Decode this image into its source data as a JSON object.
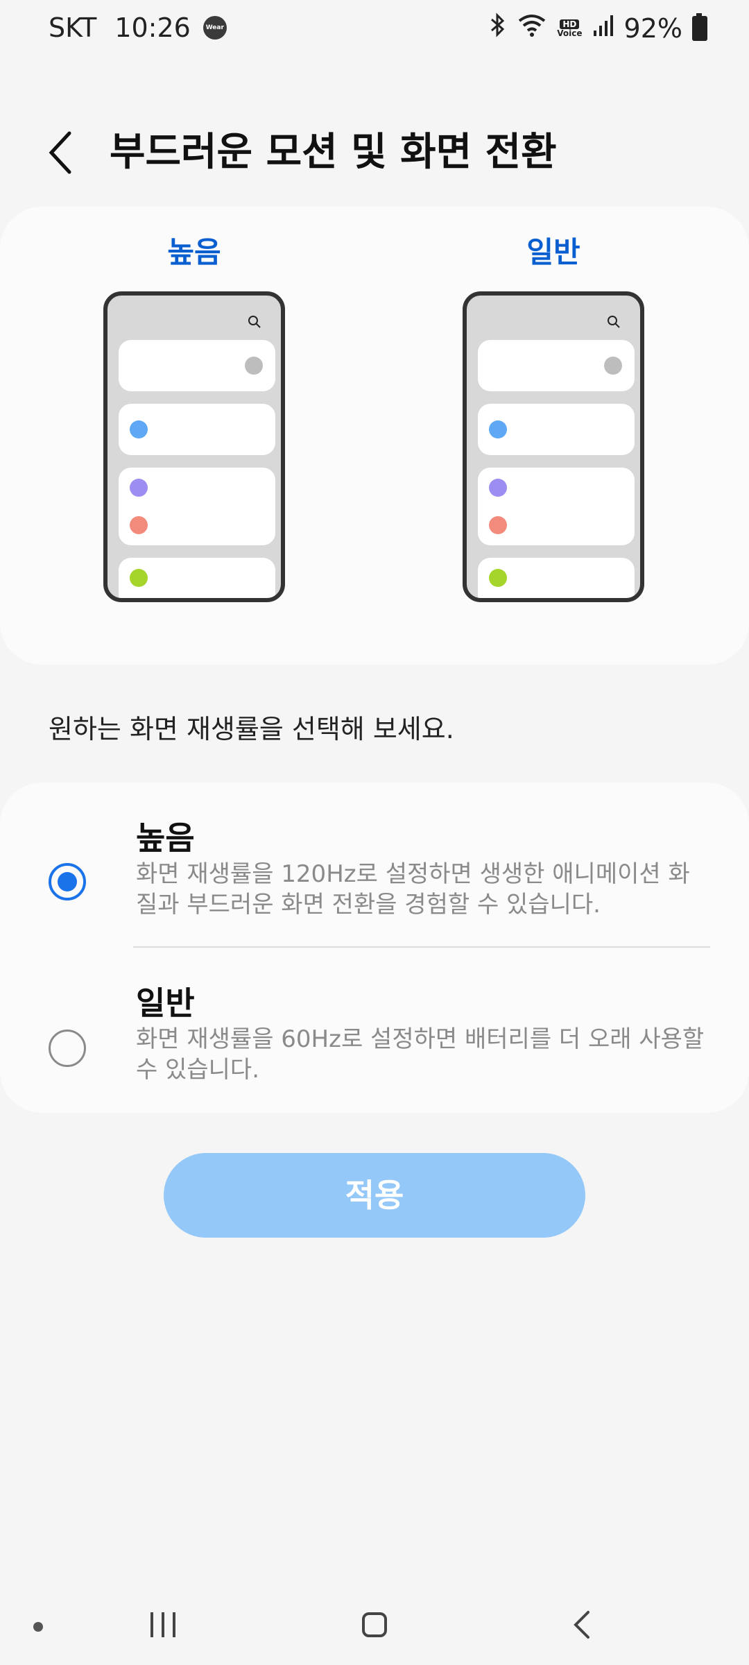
{
  "status_bar": {
    "carrier": "SKT",
    "time": "10:26",
    "wear_icon_label": "Wear",
    "hd_voice_top": "HD",
    "hd_voice_bottom": "Voice",
    "battery": "92%"
  },
  "header": {
    "title": "부드러운 모션 및 화면 전환"
  },
  "preview": {
    "high_label": "높음",
    "normal_label": "일반"
  },
  "description": "원하는 화면 재생률을 선택해 보세요.",
  "options": [
    {
      "title": "높음",
      "description": "화면 재생률을 120Hz로 설정하면 생생한 애니메이션 화질과 부드러운 화면 전환을 경험할 수 있습니다.",
      "selected": true
    },
    {
      "title": "일반",
      "description": "화면 재생률을 60Hz로 설정하면 배터리를 더 오래 사용할 수 있습니다.",
      "selected": false
    }
  ],
  "apply_button": "적용",
  "colors": {
    "accent": "#1a73e8",
    "preview_label": "#0a5fd0",
    "apply_disabled": "#94c8f8",
    "dot_gray": "#bdbdbd",
    "dot_blue": "#5ea8f5",
    "dot_purple": "#9c8df2",
    "dot_red": "#f38b7d",
    "dot_green": "#a5d42a"
  },
  "icons": {
    "back": "chevron-left-icon",
    "search": "search-icon",
    "bluetooth": "bluetooth-icon",
    "wifi": "wifi-icon",
    "signal": "signal-icon",
    "battery": "battery-icon",
    "nav_recents": "recents-icon",
    "nav_home": "home-icon",
    "nav_back": "back-icon"
  }
}
